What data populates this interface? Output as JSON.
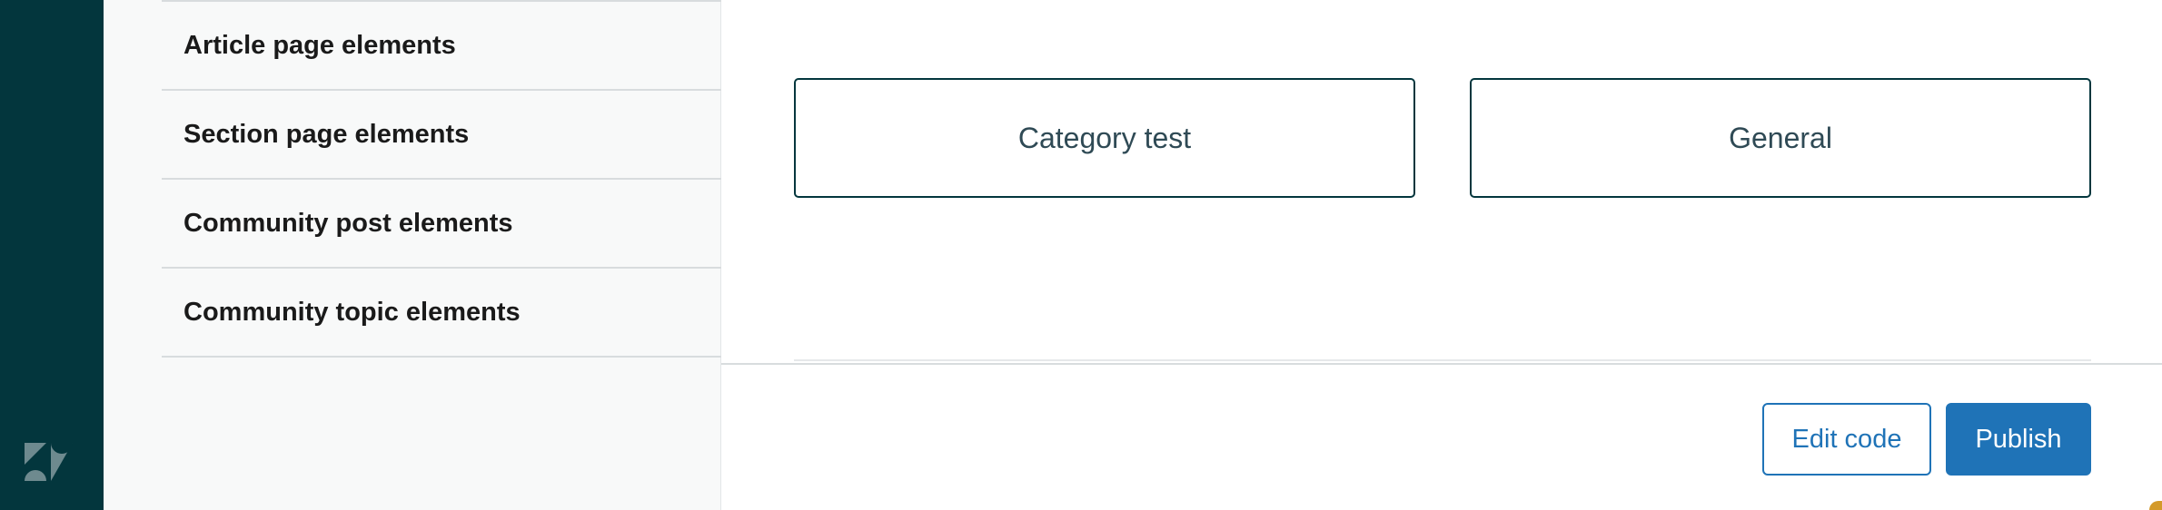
{
  "sidebar": {
    "items": [
      {
        "label": "Article page elements",
        "icon": "chevron-right-icon"
      },
      {
        "label": "Section page elements",
        "icon": "chevron-right-icon"
      },
      {
        "label": "Community post elements",
        "icon": "chevron-right-icon"
      },
      {
        "label": "Community topic elements",
        "icon": "chevron-right-icon"
      }
    ]
  },
  "brand": {
    "logo": "zendesk-logo-icon"
  },
  "preview": {
    "cards": [
      {
        "label": "Category test"
      },
      {
        "label": "General"
      }
    ]
  },
  "footer": {
    "edit_code_label": "Edit code",
    "publish_label": "Publish"
  },
  "colors": {
    "rail": "#03363d",
    "accent": "#1f73b7",
    "panel_bg": "#f8f9f9",
    "card_border": "#03363d"
  }
}
